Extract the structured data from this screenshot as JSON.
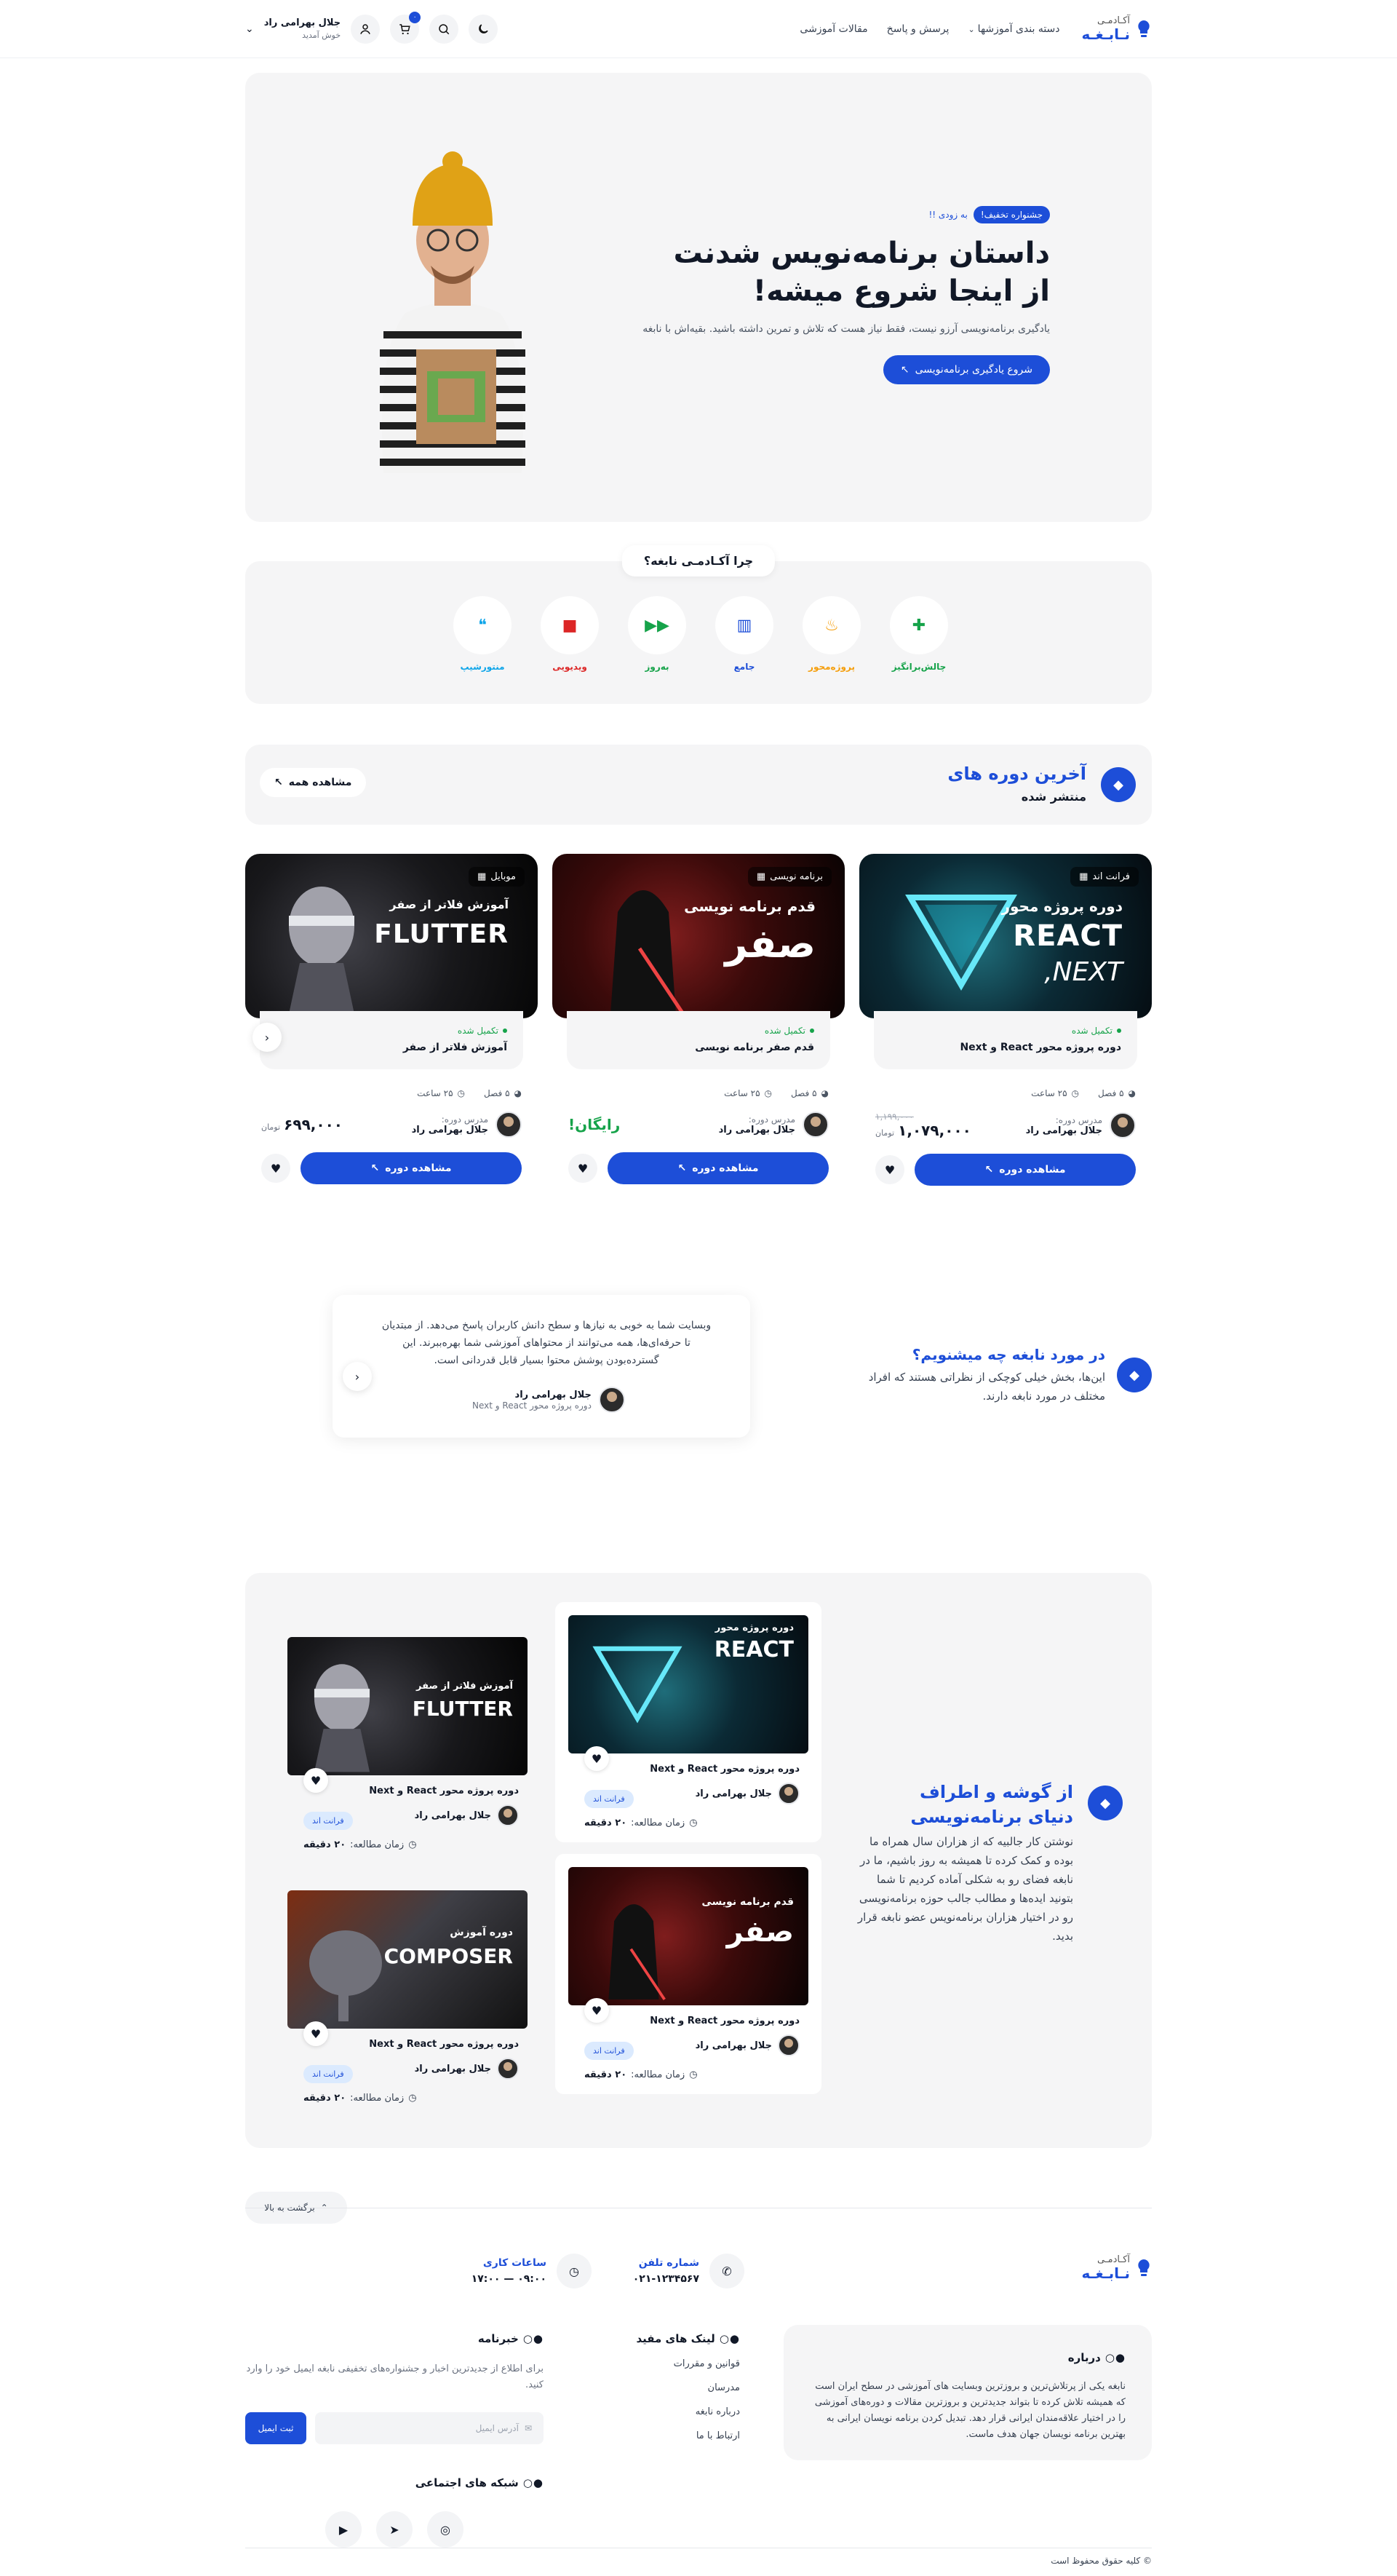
{
  "header": {
    "logo_line1": "آکـادمـی",
    "logo_line2": "نـابـغـه",
    "nav": [
      "دسته بندی آموزشها",
      "پرسش و پاسخ",
      "مقالات آموزشی"
    ],
    "cart_count": "۰",
    "user_name": "جلال بهرامی راد",
    "user_welcome": "خوش آمدید"
  },
  "hero": {
    "badge": "جشنواره تخفیف!",
    "soon": "به زودی !!",
    "title_line1": "داستان برنامه‌نویس شدنت",
    "title_line2": "از اینجا شروع میشه!",
    "desc": "یادگیری برنامه‌نویسی آرزو نیست، فقط نیاز هست که تلاش و تمرین داشته باشید. بقیه‌اش با نابغه",
    "cta": "شروع یادگیری برنامه‌نویسی"
  },
  "why": {
    "title": "چرا آکـادمـی نابغه؟",
    "features": [
      {
        "label": "چالش‌برانگیز",
        "icon": "puzzle-icon",
        "color": "#16a34a"
      },
      {
        "label": "پروژه‌محور",
        "icon": "fire-icon",
        "color": "#f59e0b"
      },
      {
        "label": "جامع",
        "icon": "book-icon",
        "color": "#1d4ed8"
      },
      {
        "label": "به‌روز",
        "icon": "forward-icon",
        "color": "#16a34a"
      },
      {
        "label": "ویدیویی",
        "icon": "video-icon",
        "color": "#dc2626"
      },
      {
        "label": "منتورشیپ",
        "icon": "chat-icon",
        "color": "#0ea5e9"
      }
    ]
  },
  "latest": {
    "title": "آخرین دوره های",
    "subtitle": "منتشر شده",
    "see_all": "مشاهده همه"
  },
  "courses": [
    {
      "tag": "فرانت اند",
      "img_title": "دوره پروژه محور",
      "img_big": "REACT",
      "status": "تکمیل شده",
      "title": "دوره پروژه محور React و Next",
      "chapters": "۵ فصل",
      "hours": "۲۵ ساعت",
      "teacher_label": "مدرس دوره:",
      "teacher": "جلال بهرامی راد",
      "old_price": "۱,۱۹۹,۰۰۰",
      "price": "۱,۰۷۹,۰۰۰",
      "currency": "تومان",
      "btn": "مشاهده دوره"
    },
    {
      "tag": "برنامه نویسی",
      "img_title": "قدم برنامه نویسی",
      "img_big": "صفر",
      "status": "تکمیل شده",
      "title": "قدم صفر برنامه نویسی",
      "chapters": "۵ فصل",
      "hours": "۲۵ ساعت",
      "teacher_label": "مدرس دوره:",
      "teacher": "جلال بهرامی راد",
      "free": "رایگان!",
      "btn": "مشاهده دوره"
    },
    {
      "tag": "موبایل",
      "img_title": "آموزش فلاتر از صفر",
      "img_big": "FLUTTER",
      "status": "تکمیل شده",
      "title": "آموزش فلاتر از صفر",
      "chapters": "۵ فصل",
      "hours": "۲۵ ساعت",
      "teacher_label": "مدرس دوره:",
      "teacher": "جلال بهرامی راد",
      "price": "۶۹۹,۰۰۰",
      "currency": "تومان",
      "btn": "مشاهده دوره"
    }
  ],
  "testimonial": {
    "title": "در مورد نابغه چه میشنویم؟",
    "desc": "این‌ها، بخش خیلی کوچکی از نظراتی هستند که افراد مختلف در مورد نابغه دارند.",
    "text": "وبسایت شما به خوبی به نیازها و سطح دانش کاربران پاسخ می‌دهد. از مبتدیان تا حرفه‌ای‌ها، همه می‌توانند از محتواهای آموزشی شما بهره‌ببرند. این گسترده‌بودن پوشش محتوا بسیار قابل قدردانی است.",
    "author": "جلال بهرامی راد",
    "role": "دوره پروژه محور React و Next"
  },
  "articles": {
    "title": "از گوشه و اطراف دنیای برنامه‌نویسی",
    "desc": "نوشتن کار جالبیه که از هزاران سال همراه ما بوده و کمک کرده تا همیشه به روز باشیم، ما در نابغه فضای رو به شکلی آماده کردیم تا شما بتونید ایده‌ها و مطالب جالب حوزه برنامه‌نویسی رو در اختیار هزاران برنامه‌نویس عضو نابغه قرار بدید.",
    "items": [
      {
        "img_title": "دوره پروژه محور",
        "img_big": "REACT",
        "title": "دوره پروژه محور React و Next",
        "author": "جلال بهرامی راد",
        "cat": "فرانت اند",
        "read_label": "زمان مطالعه:",
        "read": "۲۰ دقیقه"
      },
      {
        "img_title": "آموزش فلاتر از صفر",
        "img_big": "FLUTTER",
        "title": "دوره پروژه محور React و Next",
        "author": "جلال بهرامی راد",
        "cat": "فرانت اند",
        "read_label": "زمان مطالعه:",
        "read": "۲۰ دقیقه"
      },
      {
        "img_title": "قدم برنامه نویسی",
        "img_big": "صفر",
        "title": "دوره پروژه محور React و Next",
        "author": "جلال بهرامی راد",
        "cat": "فرانت اند",
        "read_label": "زمان مطالعه:",
        "read": "۲۰ دقیقه"
      },
      {
        "img_title": "دوره آموزش",
        "img_big": "COMPOSER",
        "title": "دوره پروژه محور React و Next",
        "author": "جلال بهرامی راد",
        "cat": "فرانت اند",
        "read_label": "زمان مطالعه:",
        "read": "۲۰ دقیقه"
      }
    ]
  },
  "footer": {
    "back_top": "برگشت به بالا",
    "phone_label": "شماره تلفن",
    "phone": "۰۲۱-۱۲۳۴۵۶۷",
    "hours_label": "ساعات کاری",
    "hours": "۰۹:۰۰ — ۱۷:۰۰",
    "about_title": "درباره",
    "about_text": "نابغه یکی از پرتلاش‌ترین و بروزترین وبسایت های آموزشی در سطح ایران است که همیشه تلاش کرده تا بتواند جدیدترین و بروزترین مقالات و دوره‌های آموزشی را در اختیار علاقه‌مندان ایرانی قرار دهد. تبدیل کردن برنامه نویسان ایرانی به بهترین برنامه نویسان جهان هدف ماست.",
    "links_title": "لینک های مفید",
    "links": [
      "قوانین و مقررات",
      "مدرسان",
      "درباره نابغه",
      "ارتباط با ما"
    ],
    "news_title": "خبرنامه",
    "news_desc": "برای اطلاع از جدیدترین اخبار و جشنواره‌های تخفیفی نابغه ایمیل خود را وارد کنید.",
    "email_placeholder": "آدرس ایمیل",
    "subscribe": "ثبت ایمیل",
    "social_title": "شبکه های اجتماعی",
    "copyright": "© کلیه حقوق محفوظ است"
  }
}
